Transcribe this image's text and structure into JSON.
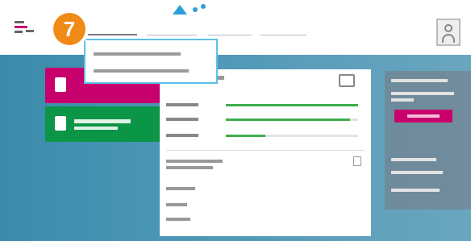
{
  "header": {
    "logo": "telekom-logo",
    "nav": [
      "",
      "",
      "",
      ""
    ],
    "user_icon": "user-avatar-icon"
  },
  "step_badge": {
    "number": "7",
    "color": "#f08a17"
  },
  "dropdown": {
    "items": [
      "",
      ""
    ],
    "border_color": "#5cc0e8"
  },
  "tiles": [
    {
      "color": "#c7006e",
      "icon": "document-icon"
    },
    {
      "color": "#0b9547",
      "icon": "user-group-icon"
    }
  ],
  "usage_panel": {
    "rows": [
      {
        "fill_fraction": 1.0
      },
      {
        "fill_fraction": 0.94
      },
      {
        "fill_fraction": 0.3
      }
    ],
    "bar_color": "#3dae4b"
  },
  "right_panel": {
    "button_color": "#c7006e"
  },
  "colors": {
    "accent": "#c7006e",
    "background": "#3a8cac"
  }
}
